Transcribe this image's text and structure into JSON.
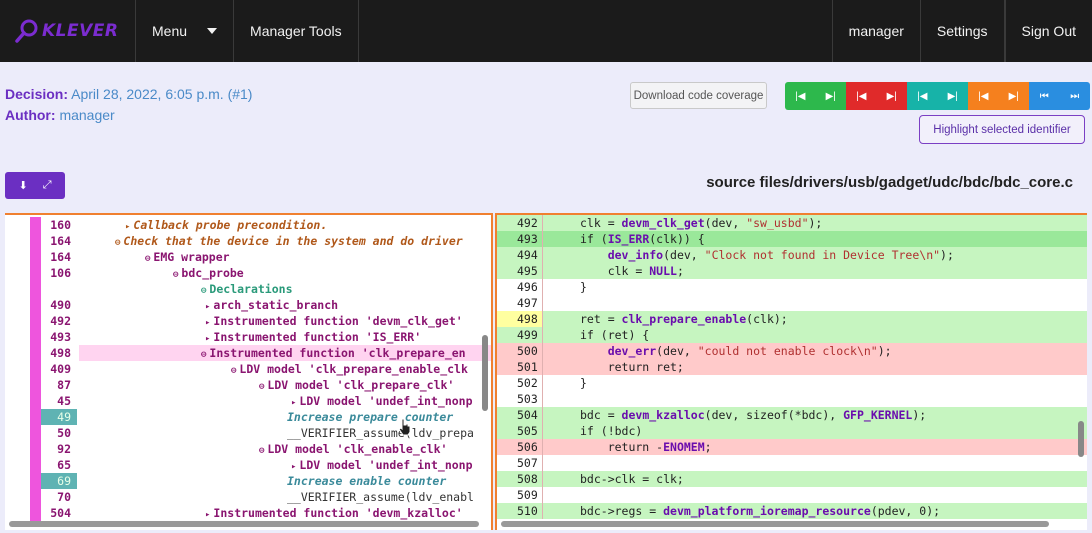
{
  "topbar": {
    "logo_text": "KLEVER",
    "menu_label": "Menu",
    "manager_tools_label": "Manager Tools",
    "user_label": "manager",
    "settings_label": "Settings",
    "signout_label": "Sign Out"
  },
  "info": {
    "decision_label": "Decision:",
    "decision_value": "April 28, 2022, 6:05 p.m. (#1)",
    "author_label": "Author:",
    "author_value": "manager"
  },
  "buttons": {
    "coverage_label": "Download code coverage",
    "highlight_label": "Highlight selected identifier"
  },
  "nav_colors": [
    "#2db84c",
    "#2db84c",
    "#e02a2a",
    "#e02a2a",
    "#17b3a8",
    "#17b3a8",
    "#f5801e",
    "#f5801e",
    "#2a8ee0",
    "#2a8ee0"
  ],
  "file_path": "source files/drivers/usb/gadget/udc/bdc/bdc_core.c",
  "trace": [
    {
      "ln": "160",
      "indent": 120,
      "icon": "▸",
      "text": "Callback probe precondition.",
      "style": "cb"
    },
    {
      "ln": "164",
      "indent": 110,
      "icon": "⊖",
      "text": "Check that the device in the system and do driver",
      "style": "cb"
    },
    {
      "ln": "164",
      "indent": 140,
      "icon": "⊖",
      "text": "EMG wrapper",
      "style": ""
    },
    {
      "ln": "106",
      "indent": 168,
      "icon": "⊖",
      "text": "bdc_probe",
      "style": ""
    },
    {
      "ln": "",
      "indent": 196,
      "icon": "⊖",
      "text": "Declarations",
      "style": "decl"
    },
    {
      "ln": "490",
      "indent": 200,
      "icon": "▸",
      "text": "arch_static_branch",
      "style": ""
    },
    {
      "ln": "492",
      "indent": 200,
      "icon": "▸",
      "text": "Instrumented function 'devm_clk_get'",
      "style": ""
    },
    {
      "ln": "493",
      "indent": 200,
      "icon": "▸",
      "text": "Instrumented function 'IS_ERR'",
      "style": ""
    },
    {
      "ln": "498",
      "indent": 196,
      "icon": "⊖",
      "text": "Instrumented function 'clk_prepare_en",
      "style": "",
      "selected": true
    },
    {
      "ln": "409",
      "indent": 226,
      "icon": "⊖",
      "text": "LDV model 'clk_prepare_enable_clk",
      "style": ""
    },
    {
      "ln": "87",
      "indent": 254,
      "icon": "⊖",
      "text": "LDV model 'clk_prepare_clk'",
      "style": ""
    },
    {
      "ln": "45",
      "indent": 286,
      "icon": "▸",
      "text": "LDV model 'undef_int_nonp",
      "style": ""
    },
    {
      "ln": "49",
      "indent": 282,
      "icon": "",
      "text": "Increase prepare counter",
      "style": "comm",
      "hl": true
    },
    {
      "ln": "50",
      "indent": 282,
      "icon": "",
      "text": "__VERIFIER_assume(ldv_prepa",
      "style": "plain"
    },
    {
      "ln": "92",
      "indent": 254,
      "icon": "⊖",
      "text": "LDV model 'clk_enable_clk'",
      "style": ""
    },
    {
      "ln": "65",
      "indent": 286,
      "icon": "▸",
      "text": "LDV model 'undef_int_nonp",
      "style": ""
    },
    {
      "ln": "69",
      "indent": 282,
      "icon": "",
      "text": "Increase enable counter",
      "style": "comm",
      "hl": true
    },
    {
      "ln": "70",
      "indent": 282,
      "icon": "",
      "text": "__VERIFIER_assume(ldv_enabl",
      "style": "plain"
    },
    {
      "ln": "504",
      "indent": 200,
      "icon": "▸",
      "text": "Instrumented function 'devm_kzalloc'",
      "style": ""
    }
  ],
  "code": [
    {
      "ln": "492",
      "cls": "g",
      "html": "clk = <span class='fn'>devm_clk_get</span>(dev, <span class='str'>\"sw_usbd\"</span>);"
    },
    {
      "ln": "493",
      "cls": "gd",
      "html": "if (<span class='mac'>IS_ERR</span>(clk)) {"
    },
    {
      "ln": "494",
      "cls": "g",
      "html": "    <span class='fn'>dev_info</span>(dev, <span class='str'>\"Clock not found in Device Tree\\n\"</span>);"
    },
    {
      "ln": "495",
      "cls": "g",
      "html": "    clk = <span class='mac'>NULL</span>;"
    },
    {
      "ln": "496",
      "cls": "",
      "html": "}"
    },
    {
      "ln": "497",
      "cls": "",
      "html": ""
    },
    {
      "ln": "498",
      "cls": "y",
      "html": "ret = <span class='fn'>clk_prepare_enable</span>(clk);"
    },
    {
      "ln": "499",
      "cls": "g",
      "html": "if (ret) {"
    },
    {
      "ln": "500",
      "cls": "r",
      "html": "    <span class='fn'>dev_err</span>(dev, <span class='str'>\"could not enable clock\\n\"</span>);"
    },
    {
      "ln": "501",
      "cls": "r",
      "html": "    return ret;"
    },
    {
      "ln": "502",
      "cls": "",
      "html": "}"
    },
    {
      "ln": "503",
      "cls": "",
      "html": ""
    },
    {
      "ln": "504",
      "cls": "g",
      "html": "bdc = <span class='fn'>devm_kzalloc</span>(dev, sizeof(*bdc), <span class='mac'>GFP_KERNEL</span>);"
    },
    {
      "ln": "505",
      "cls": "g",
      "html": "if (!bdc)"
    },
    {
      "ln": "506",
      "cls": "r",
      "html": "    return -<span class='mac'>ENOMEM</span>;"
    },
    {
      "ln": "507",
      "cls": "",
      "html": ""
    },
    {
      "ln": "508",
      "cls": "g",
      "html": "bdc-&gt;clk = clk;"
    },
    {
      "ln": "509",
      "cls": "",
      "html": ""
    },
    {
      "ln": "510",
      "cls": "g",
      "html": "bdc-&gt;regs = <span class='fn'>devm_platform_ioremap_resource</span>(pdev, 0);"
    }
  ]
}
